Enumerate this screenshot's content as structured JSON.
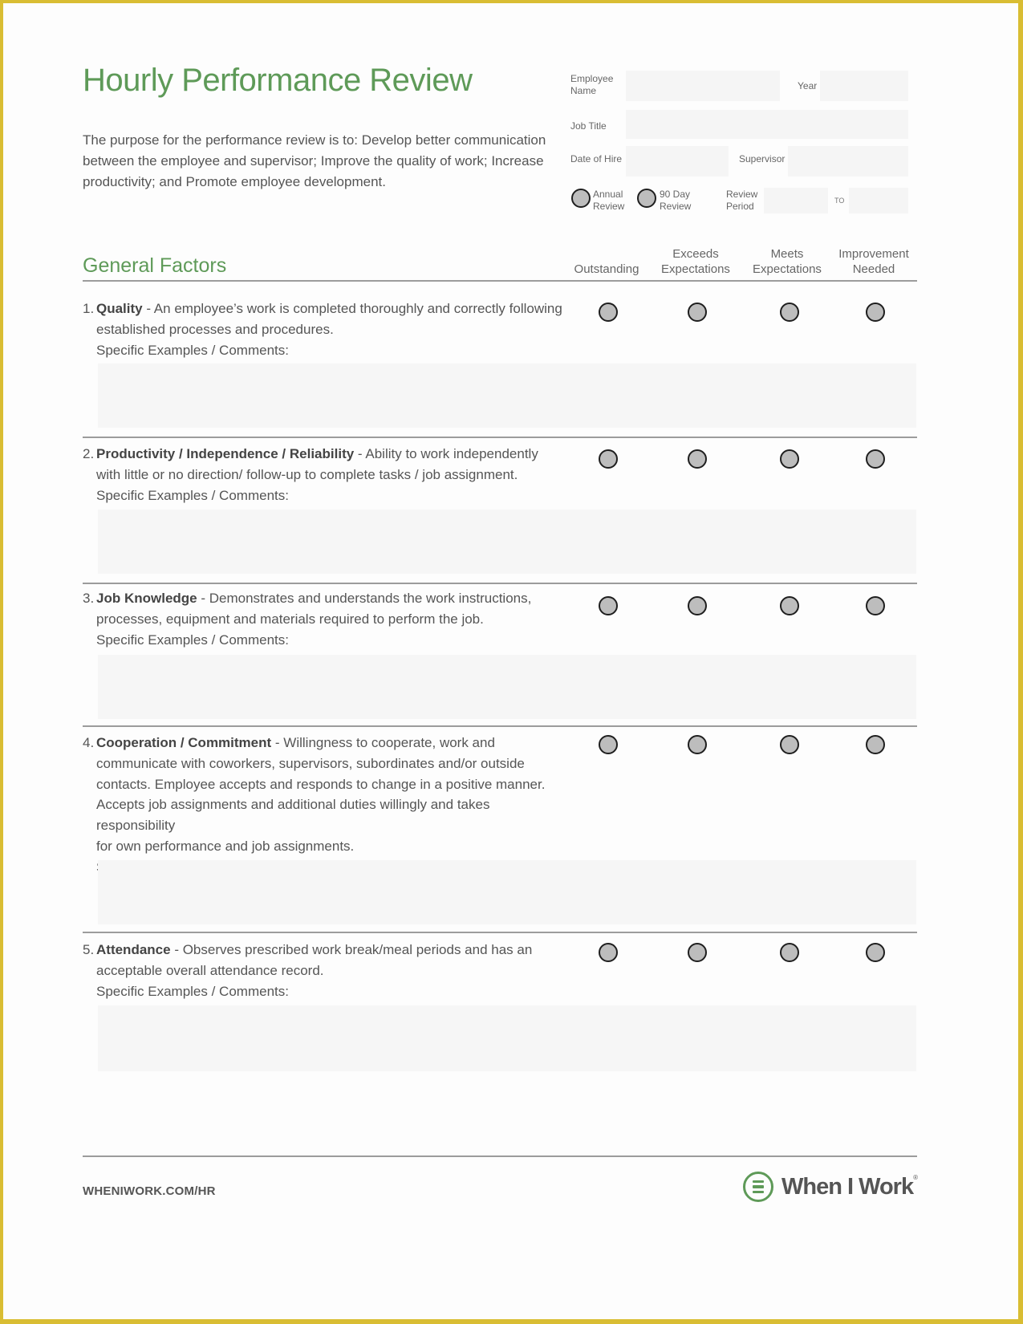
{
  "document": {
    "title": "Hourly Performance Review",
    "intro": "The purpose for the performance review is to: Develop better communication between the employee and supervisor; Improve the quality of work; Increase productivity; and Promote employee development."
  },
  "header_fields": {
    "employee_name_label_1": "Employee",
    "employee_name_label_2": "Name",
    "employee_name_value": "",
    "year_label": "Year",
    "year_value": "",
    "job_title_label": "Job Title",
    "job_title_value": "",
    "date_of_hire_label": "Date of Hire",
    "date_of_hire_value": "",
    "supervisor_label": "Supervisor",
    "supervisor_value": "",
    "review_type_options": [
      {
        "line1": "Annual",
        "line2": "Review",
        "selected": false
      },
      {
        "line1": "90 Day",
        "line2": "Review",
        "selected": false
      }
    ],
    "review_period_label_1": "Review",
    "review_period_label_2": "Period",
    "review_period_from": "",
    "review_period_to_label": "TO",
    "review_period_to": ""
  },
  "general_factors": {
    "section_title": "General Factors",
    "rating_columns": [
      {
        "line1": "",
        "line2": "Outstanding"
      },
      {
        "line1": "Exceeds",
        "line2": "Expectations"
      },
      {
        "line1": "Meets",
        "line2": "Expectations"
      },
      {
        "line1": "Improvement",
        "line2": "Needed"
      }
    ],
    "comments_label": "Specific Examples / Comments:",
    "items": [
      {
        "number": "1.",
        "name": "Quality",
        "lines": [
          "- An employee’s work is completed thoroughly and correctly following",
          "established processes and procedures."
        ],
        "rating": null,
        "comments": ""
      },
      {
        "number": "2.",
        "name": "Productivity / Independence / Reliability",
        "lines": [
          "- Ability to work independently",
          "with little or no direction/ follow-up to complete tasks / job assignment."
        ],
        "rating": null,
        "comments": ""
      },
      {
        "number": "3.",
        "name": "Job Knowledge",
        "lines": [
          "- Demonstrates and understands the work instructions,",
          "processes, equipment and materials required to perform the job."
        ],
        "rating": null,
        "comments": ""
      },
      {
        "number": "4.",
        "name": "Cooperation / Commitment",
        "lines": [
          "- Willingness to cooperate, work and",
          "communicate with coworkers, supervisors, subordinates and/or outside",
          "contacts. Employee accepts and responds to change in a positive manner.",
          "Accepts job assignments and additional duties willingly and takes responsibility",
          "for own  performance and job assignments."
        ],
        "rating": null,
        "comments": ""
      },
      {
        "number": "5.",
        "name": "Attendance",
        "lines": [
          "- Observes prescribed work break/meal periods and has an",
          "acceptable overall attendance record."
        ],
        "rating": null,
        "comments": ""
      }
    ]
  },
  "footer": {
    "url": "WHENIWORK.COM/HR",
    "logo_text": "When I Work",
    "logo_reg": "®",
    "logo_icon": "when-i-work-logo-icon"
  },
  "colors": {
    "accent_green": "#5e9a58",
    "text_gray": "#555555",
    "border_yellow": "#d9bd33"
  }
}
